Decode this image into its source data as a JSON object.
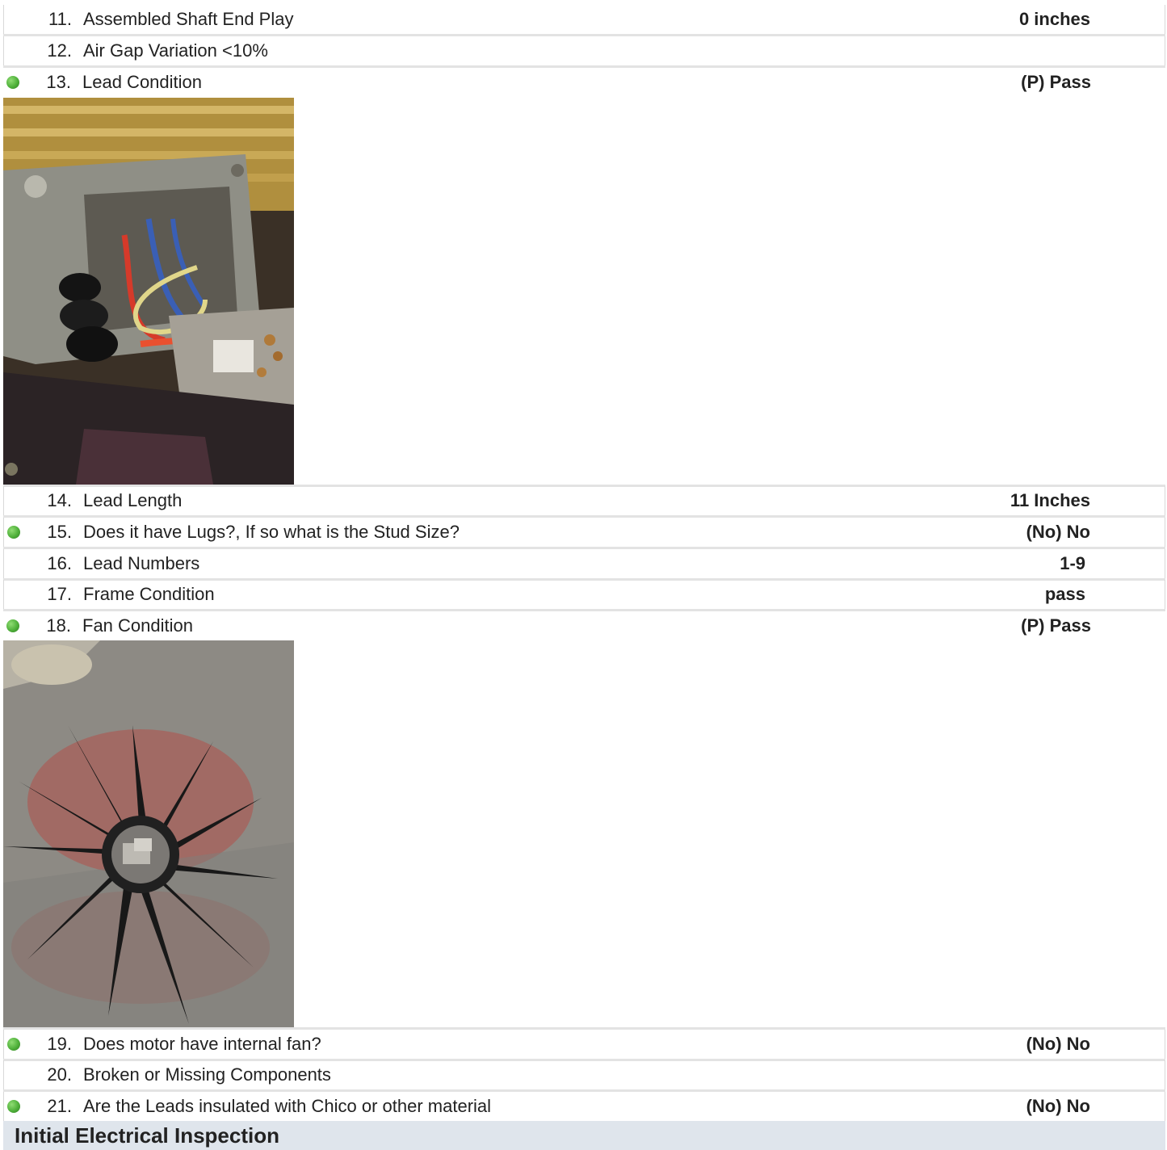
{
  "items": [
    {
      "number": "11.",
      "label": "Assembled Shaft End Play",
      "value": "0 inches",
      "status_dot": false
    },
    {
      "number": "12.",
      "label": "Air Gap Variation <10%",
      "value": "",
      "status_dot": false
    },
    {
      "number": "13.",
      "label": "Lead Condition",
      "value": "(P) Pass",
      "status_dot": true
    },
    {
      "number": "14.",
      "label": "Lead Length",
      "value": "11 Inches",
      "status_dot": false
    },
    {
      "number": "15.",
      "label": "Does it have Lugs?, If so what is the Stud Size?",
      "value": "(No) No",
      "status_dot": true
    },
    {
      "number": "16.",
      "label": "Lead Numbers",
      "value": "1-9",
      "status_dot": false
    },
    {
      "number": "17.",
      "label": "Frame Condition",
      "value": "pass",
      "status_dot": false
    },
    {
      "number": "18.",
      "label": "Fan Condition",
      "value": "(P) Pass",
      "status_dot": true
    },
    {
      "number": "19.",
      "label": "Does motor have internal fan?",
      "value": "(No) No",
      "status_dot": true
    },
    {
      "number": "20.",
      "label": "Broken or Missing Components",
      "value": "",
      "status_dot": false
    },
    {
      "number": "21.",
      "label": "Are the Leads insulated with Chico or other material",
      "value": "(No) No",
      "status_dot": true
    }
  ],
  "section_heading": "Initial Electrical Inspection",
  "colors": {
    "status_dot": "#4fb03a",
    "section_bg": "#dfe5ec",
    "separator": "#e3e3e3"
  }
}
